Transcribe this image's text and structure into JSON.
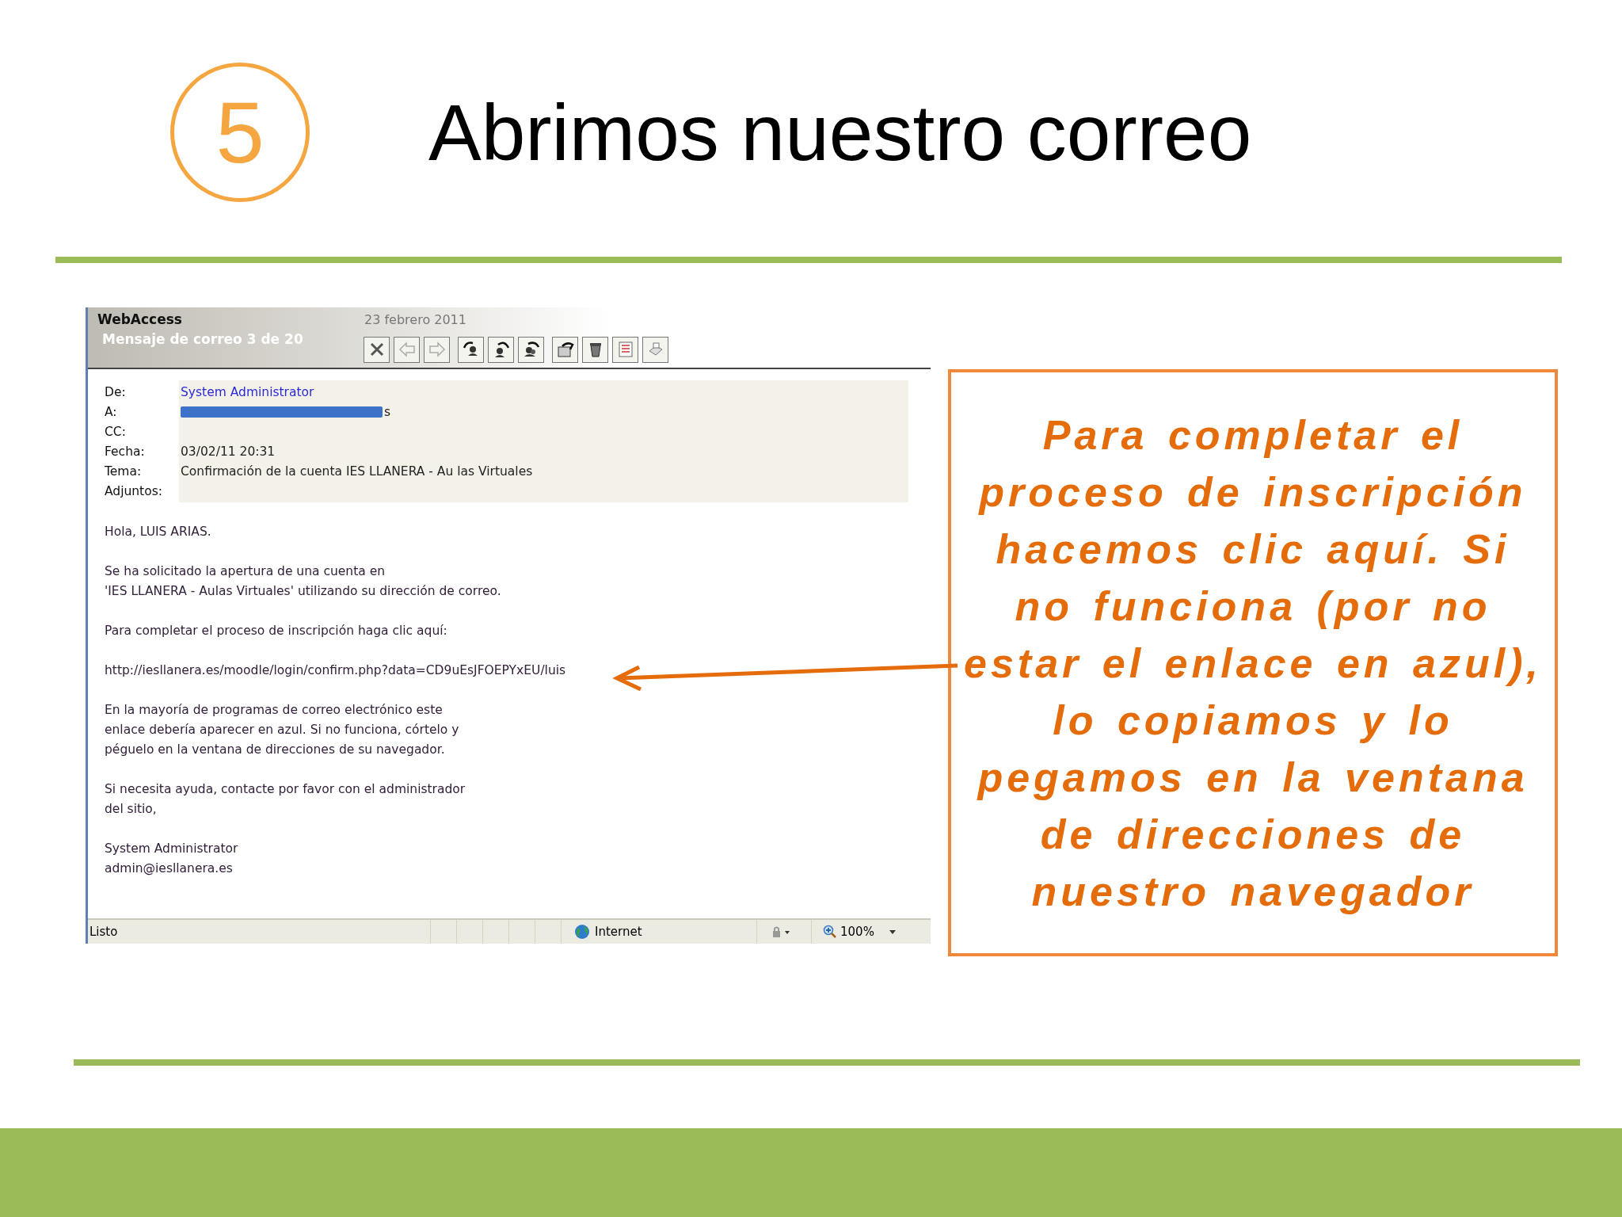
{
  "step_badge": "5",
  "title": "Abrimos nuestro correo",
  "email": {
    "app_name": "WebAccess",
    "date": "23 febrero 2011",
    "message_counter": "Mensaje de correo 3 de 20",
    "headers": [
      {
        "label": "De:",
        "value": "System Administrator",
        "kind": "link"
      },
      {
        "label": "A:",
        "value": "s",
        "kind": "redacted"
      },
      {
        "label": "CC:"
      },
      {
        "label": "Fecha:",
        "value": "03/02/11  20:31",
        "kind": "text"
      },
      {
        "label": "Tema:",
        "value": "Confirmación de la cuenta IES LLANERA - Au las Virtuales",
        "kind": "text"
      },
      {
        "label": "Adjuntos:"
      }
    ],
    "body": [
      "Hola, LUIS ARIAS.",
      "Se ha solicitado la apertura de una cuenta en\n'IES LLANERA - Aulas Virtuales' utilizando su dirección de correo.",
      "Para completar el proceso de inscripción haga clic aquí:",
      "http://iesllanera.es/moodle/login/confirm.php?data=CD9uEsJFOEPYxEU/luis",
      "En la mayoría de programas de correo electrónico este\nenlace debería aparecer en azul. Si no funciona, córtelo y\npéguelo en la ventana de direcciones de su navegador.",
      "Si necesita ayuda, contacte por favor con el administrador\ndel sitio,",
      "System Administrator\nadmin@iesllanera.es"
    ],
    "status_bar": {
      "status": "Listo",
      "zone": "Internet",
      "zoom": "100%"
    }
  },
  "callout": {
    "text": "Para completar el proceso de inscripción hacemos clic aquí. Si no funciona (por no estar el enlace en azul), lo copiamos y lo pegamos en la ventana de direcciones de nuestro navegador"
  }
}
